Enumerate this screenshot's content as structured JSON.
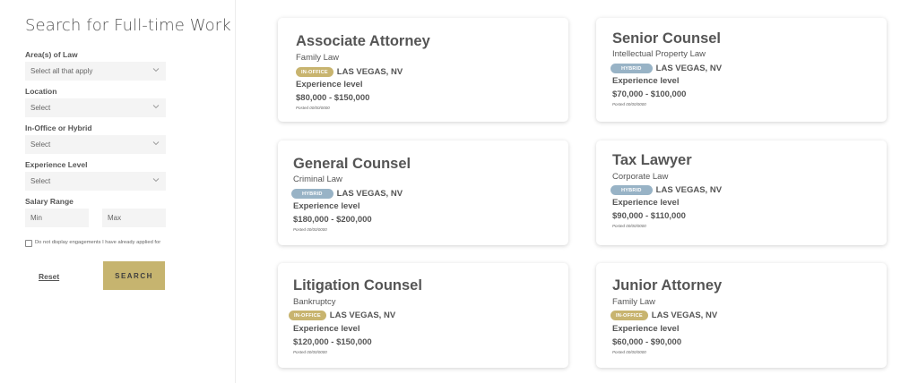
{
  "sidebar": {
    "title": "Search for Full-time Work",
    "areas_label": "Area(s) of Law",
    "areas_placeholder": "Select all that apply",
    "location_label": "Location",
    "location_value": "Select",
    "office_label": "In-Office or Hybrid",
    "office_value": "Select",
    "experience_label": "Experience Level",
    "experience_value": "Select",
    "salary_label": "Salary Range",
    "salary_min_placeholder": "Min",
    "salary_max_placeholder": "Max",
    "checkbox_label": "Do not display engagements I have already applied for",
    "reset_label": "Reset",
    "search_label": "SEARCH"
  },
  "jobs": [
    {
      "title": "Associate Attorney",
      "area": "Family Law",
      "badge": "IN-OFFICE",
      "location": "LAS VEGAS, NV",
      "experience": "Experience level",
      "salary": "$80,000 - $150,000",
      "posted": "Posted 00/00/0000"
    },
    {
      "title": "Senior Counsel",
      "area": "Intellectual Property Law",
      "badge": "HYBRID",
      "location": "LAS VEGAS, NV",
      "experience": "Experience level",
      "salary": "$70,000 - $100,000",
      "posted": "Posted 00/00/0000"
    },
    {
      "title": "General Counsel",
      "area": "Criminal Law",
      "badge": "HYBRID",
      "location": "LAS VEGAS, NV",
      "experience": "Experience level",
      "salary": "$180,000 - $200,000",
      "posted": "Posted 00/00/0000"
    },
    {
      "title": "Tax Lawyer",
      "area": "Corporate Law",
      "badge": "HYBRID",
      "location": "LAS VEGAS, NV",
      "experience": "Experience level",
      "salary": "$90,000 - $110,000",
      "posted": "Posted 00/00/0000"
    },
    {
      "title": "Litigation Counsel",
      "area": "Bankruptcy",
      "badge": "IN-OFFICE",
      "location": "LAS VEGAS, NV",
      "experience": "Experience level",
      "salary": "$120,000 - $150,000",
      "posted": "Posted 00/00/0000"
    },
    {
      "title": "Junior Attorney",
      "area": "Family Law",
      "badge": "IN-OFFICE",
      "location": "LAS VEGAS, NV",
      "experience": "Experience level",
      "salary": "$60,000 - $90,000",
      "posted": "Posted 00/00/0000"
    }
  ],
  "colors": {
    "accent": "#c6b46f",
    "in_office_badge": "#c8b46f",
    "hybrid_badge": "#98b3c6"
  },
  "icons": {
    "select_chevron": "chevron-down-icon",
    "checkbox": "checkbox-icon"
  }
}
